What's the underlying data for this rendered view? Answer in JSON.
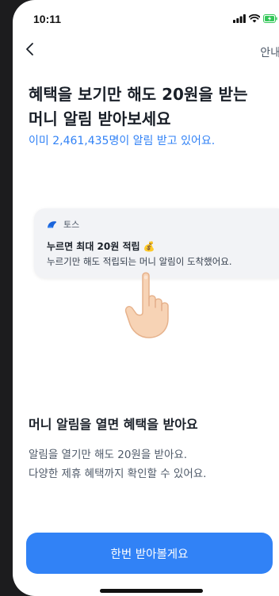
{
  "status_bar": {
    "time": "10:11",
    "icons": [
      "signal-icon",
      "wifi-icon",
      "battery-charging-icon"
    ]
  },
  "nav": {
    "back_icon": "chevron-left-icon",
    "info_label": "안내"
  },
  "headline": {
    "title": "혜택을 보기만 해도 20원을 받는\n머니 알림 받아보세요",
    "subtitle": "이미 2,461,435명이 알림 받고 있어요."
  },
  "notification": {
    "app_icon": "toss-logo-icon",
    "app_name": "토스",
    "title": "누르면 최대 20원 적립 💰",
    "body": "누르기만 해도 적립되는 머니 알림이 도착했어요."
  },
  "section": {
    "title": "머니 알림을 열면 혜택을 받아요",
    "description": "알림을 열기만 해도 20원을 받아요.\n다양한 제휴 혜택까지 확인할 수 있어요."
  },
  "cta": {
    "label": "한번 받아볼게요"
  },
  "colors": {
    "accent": "#3182f6",
    "text_primary": "#191f28",
    "text_secondary": "#4e5968",
    "card_bg": "#f2f3f6",
    "battery_green": "#34c759"
  }
}
